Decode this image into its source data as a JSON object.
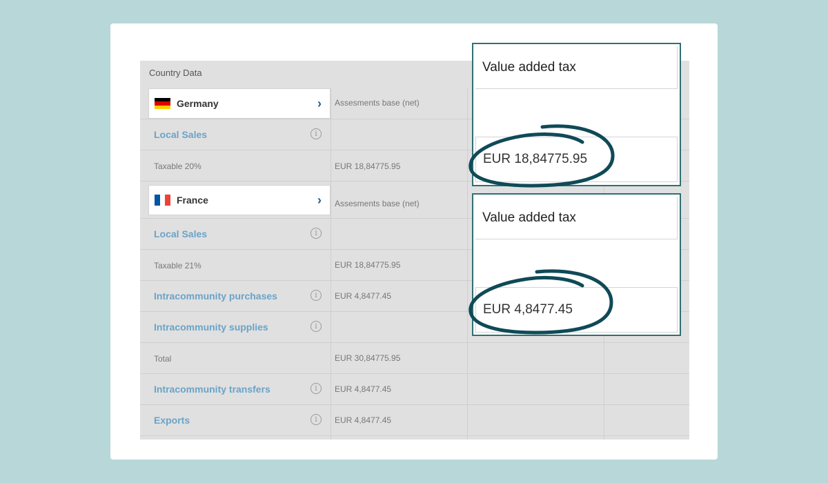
{
  "panel": {
    "header": "Country Data"
  },
  "countries": [
    {
      "name": "Germany",
      "assessment_label": "Assesments base (net)",
      "rows": [
        {
          "label": "Local Sales",
          "type": "link",
          "info": true,
          "amount": ""
        },
        {
          "label": "Taxable 20%",
          "type": "plain",
          "info": false,
          "amount": "EUR 18,84775.95"
        }
      ]
    },
    {
      "name": "France",
      "assessment_label": "Assesments base (net)",
      "rows": [
        {
          "label": "Local Sales",
          "type": "link",
          "info": true,
          "amount": ""
        },
        {
          "label": "Taxable 21%",
          "type": "plain",
          "info": false,
          "amount": "EUR 18,84775.95"
        },
        {
          "label": "Intracommunity purchases",
          "type": "link",
          "info": true,
          "amount": "EUR 4,8477.45"
        },
        {
          "label": "Intracommunity supplies",
          "type": "link",
          "info": true,
          "amount": ""
        },
        {
          "label": "Total",
          "type": "plain",
          "info": false,
          "amount": "EUR 30,84775.95"
        },
        {
          "label": "Intracommunity transfers",
          "type": "link",
          "info": true,
          "amount": "EUR 4,8477.45"
        },
        {
          "label": "Exports",
          "type": "link",
          "info": true,
          "amount": "EUR 4,8477.45"
        }
      ]
    }
  ],
  "callouts": [
    {
      "title": "Value added tax",
      "value": "EUR 18,84775.95"
    },
    {
      "title": "Value added tax",
      "value": "EUR 4,8477.45"
    }
  ],
  "icons": {
    "chevron": "chevron-right-icon",
    "info": "info-icon",
    "info_glyph": "i",
    "chevron_glyph": "›"
  },
  "colors": {
    "accent": "#2f6f73",
    "link": "#6aa3c7",
    "chevron": "#1c5f86",
    "background": "#b8d7d8"
  }
}
